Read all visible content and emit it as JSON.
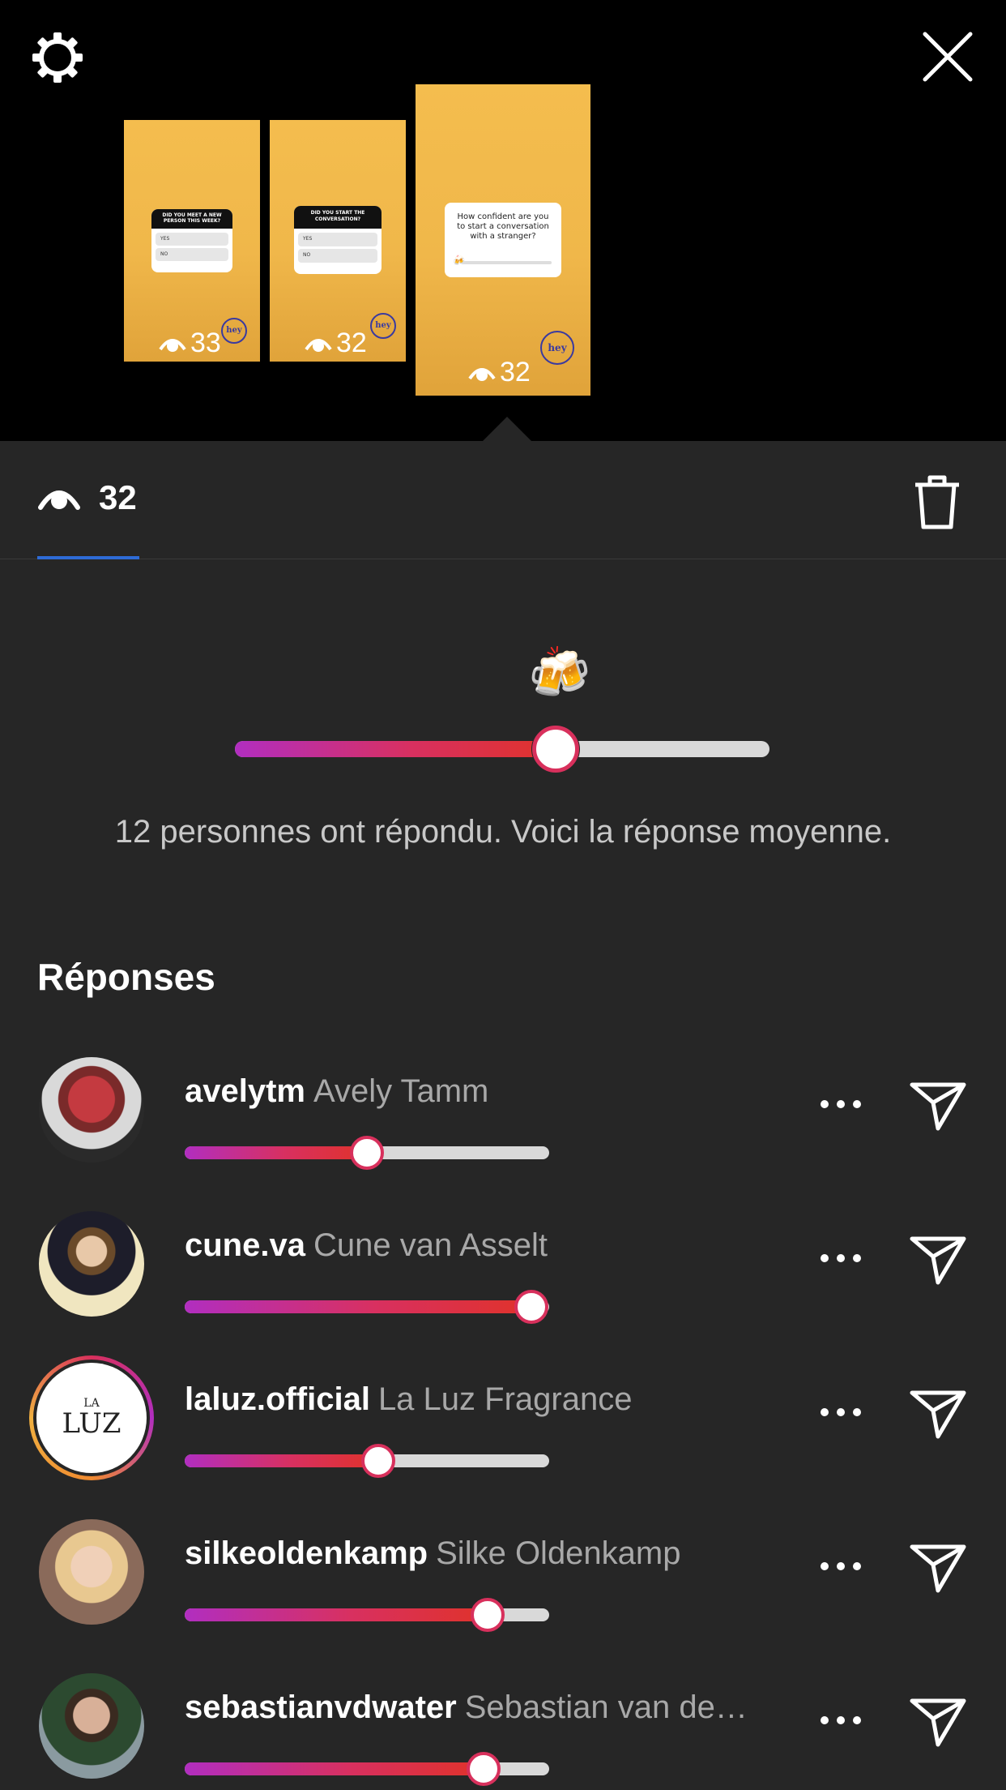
{
  "header": {
    "settings_icon": "gear-icon",
    "close_icon": "close-icon"
  },
  "stories": [
    {
      "question": "DID YOU MEET A NEW PERSON THIS WEEK?",
      "options": [
        "YES",
        "NO"
      ],
      "views": "33",
      "logo": "hey"
    },
    {
      "question": "DID YOU START THE CONVERSATION?",
      "options": [
        "YES",
        "NO"
      ],
      "views": "32",
      "logo": "hey"
    },
    {
      "question": "How confident are you to start a conversation with a stranger?",
      "views": "32",
      "logo": "hey",
      "selected": true
    }
  ],
  "tabbar": {
    "views_count": "32",
    "eye_icon": "eye-icon",
    "delete_icon": "trash-icon"
  },
  "summary": {
    "emoji": "🍻",
    "average_value": 0.6,
    "text": "12 personnes ont répondu. Voici la réponse moyenne."
  },
  "responses_title": "Réponses",
  "responses": [
    {
      "username": "avelytm",
      "full_name": "Avely Tamm",
      "value": 0.5
    },
    {
      "username": "cune.va",
      "full_name": "Cune van Asselt",
      "value": 0.95
    },
    {
      "username": "laluz.official",
      "full_name": "La Luz Fragrance",
      "value": 0.53,
      "avatar_text_top": "LA",
      "avatar_text_bottom": "LUZ"
    },
    {
      "username": "silkeoldenkamp",
      "full_name": "Silke Oldenkamp",
      "value": 0.83
    },
    {
      "username": "sebastianvdwater",
      "full_name": "Sebastian van de…",
      "value": 0.82
    }
  ],
  "colors": {
    "panel_bg": "#262626",
    "story_bg": "#f2b94b",
    "slider_start": "#b12ec0",
    "slider_end": "#e0322a",
    "accent_underline": "#2e6bd6"
  }
}
